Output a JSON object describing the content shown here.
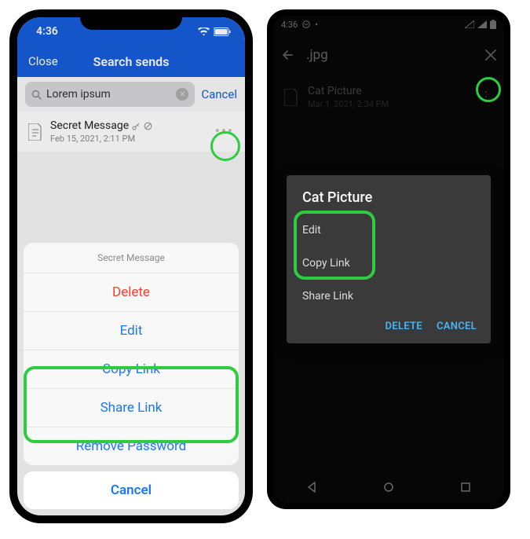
{
  "ios": {
    "status": {
      "time": "4:36"
    },
    "header": {
      "close": "Close",
      "title": "Search sends"
    },
    "search": {
      "value": "Lorem ipsum",
      "cancel": "Cancel"
    },
    "item": {
      "title": "Secret Message",
      "sub": "Feb 15, 2021, 2:11 PM"
    },
    "sheet": {
      "title": "Secret Message",
      "delete": "Delete",
      "edit": "Edit",
      "copy": "Copy Link",
      "share": "Share Link",
      "remove": "Remove Password",
      "cancel": "Cancel"
    }
  },
  "android": {
    "status": {
      "time": "4:36"
    },
    "header": {
      "title": ".jpg"
    },
    "item": {
      "title": "Cat Picture",
      "sub": "Mar 1, 2021, 2:34 PM"
    },
    "dialog": {
      "title": "Cat Picture",
      "edit": "Edit",
      "copy": "Copy Link",
      "share": "Share Link",
      "delete": "DELETE",
      "cancel": "CANCEL"
    }
  }
}
